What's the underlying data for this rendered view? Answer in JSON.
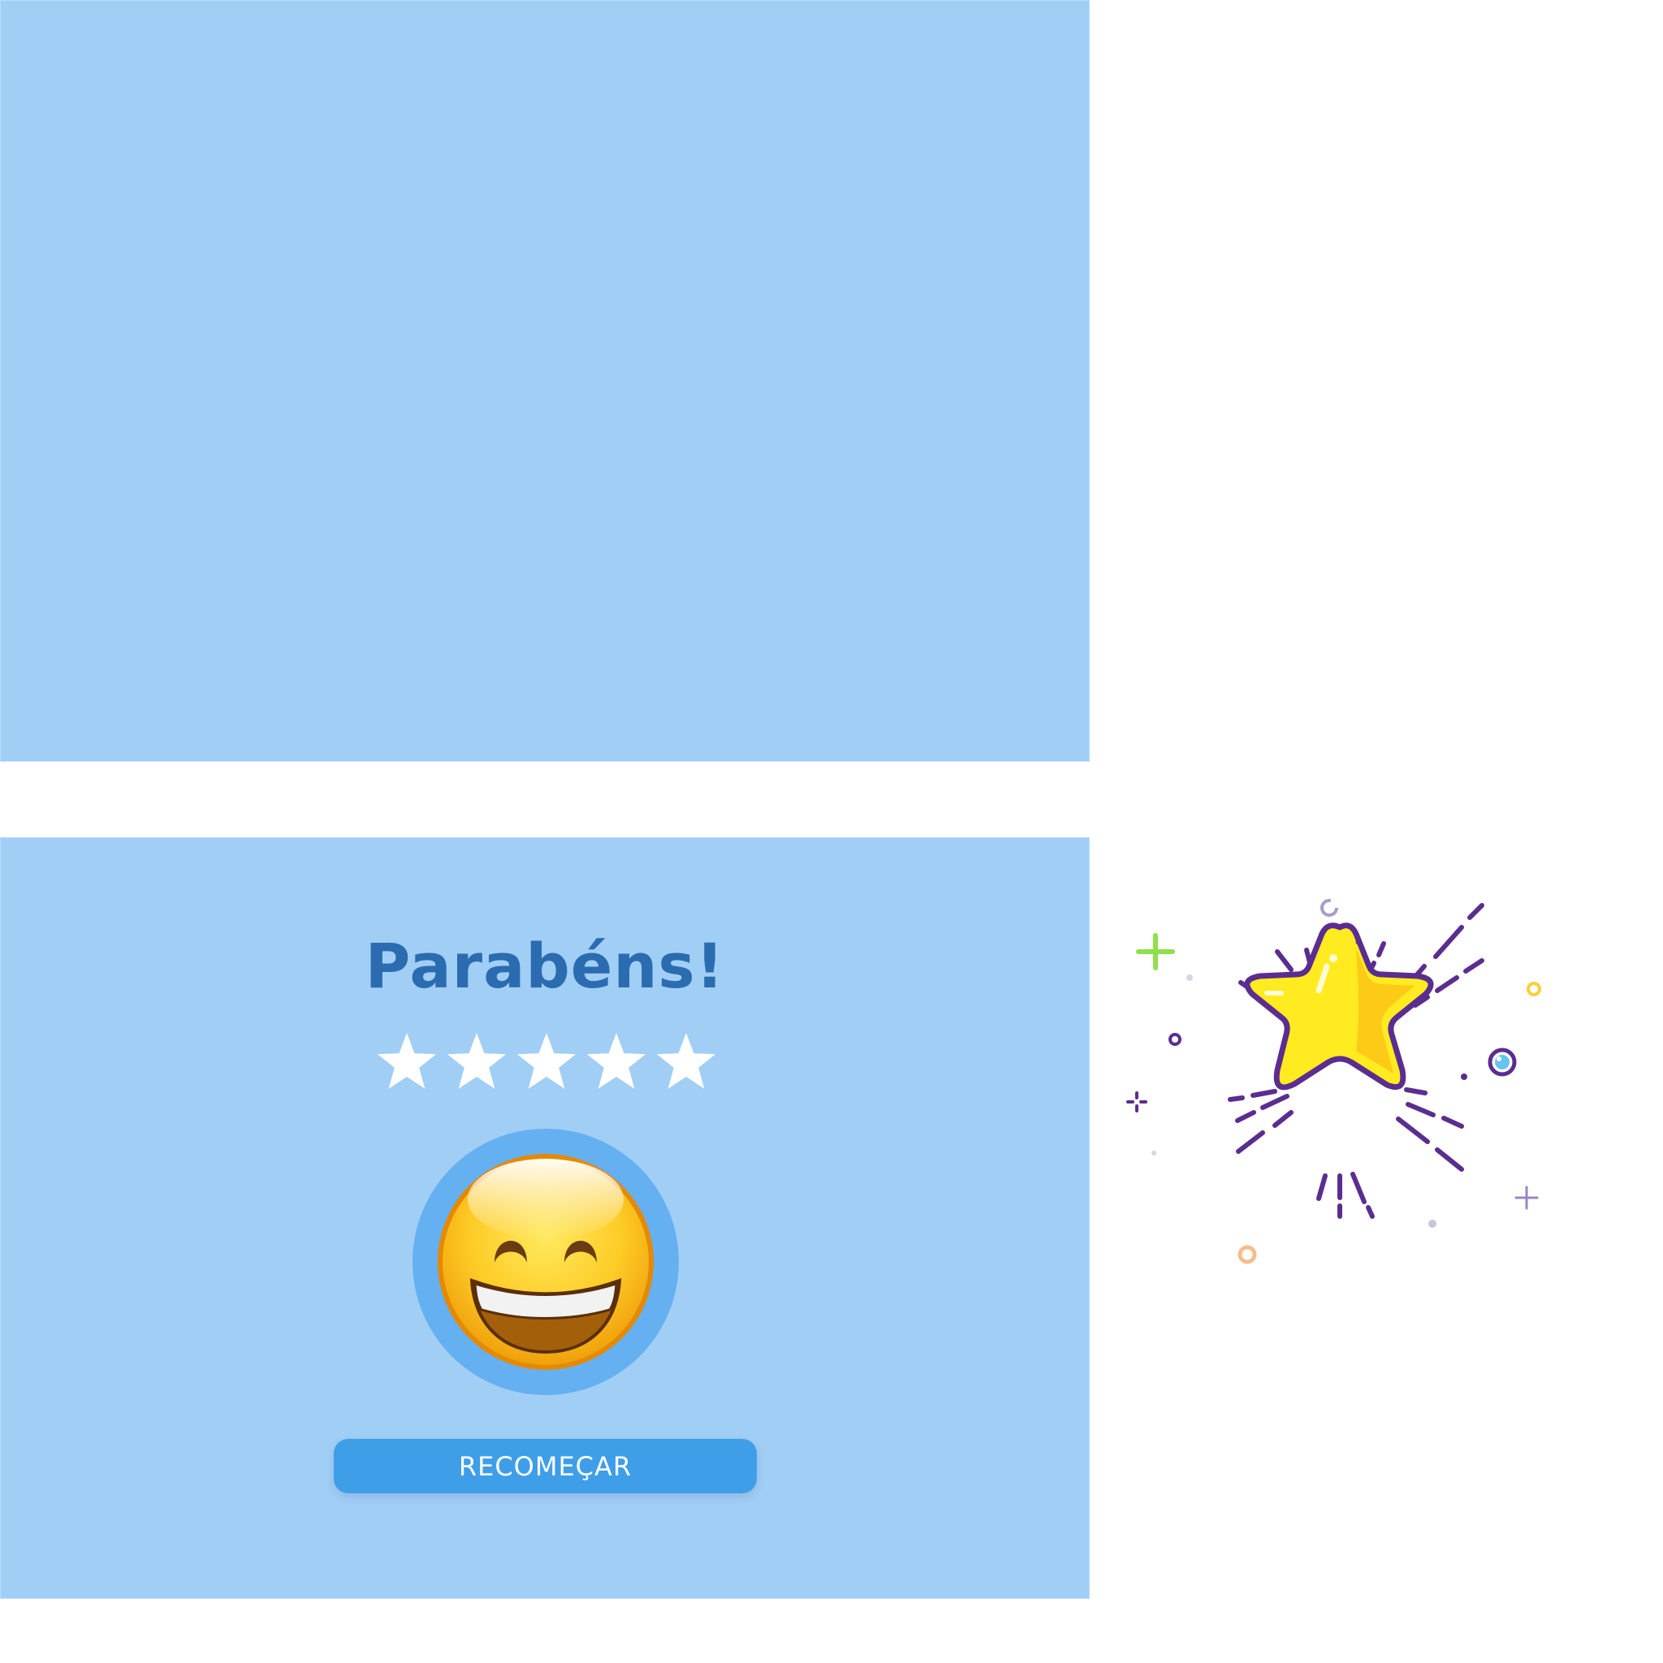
{
  "screen": {
    "background_color": "#a1cef5",
    "page_background": "#ffffff"
  },
  "result": {
    "title": "Parabéns!",
    "title_color": "#2b6cb0",
    "rating": 5,
    "rating_max": 5,
    "star_color": "#ffffff",
    "emoji": "grinning-face-with-smiling-eyes",
    "emoji_ring_color": "#65b0f0"
  },
  "actions": {
    "restart_label": "RECOMEÇAR",
    "restart_color": "#3f9ee8"
  },
  "illustration": {
    "icon": "sparkling-star-icon",
    "star_fill": "#ffeb1f",
    "outline_color": "#5b2d90"
  }
}
